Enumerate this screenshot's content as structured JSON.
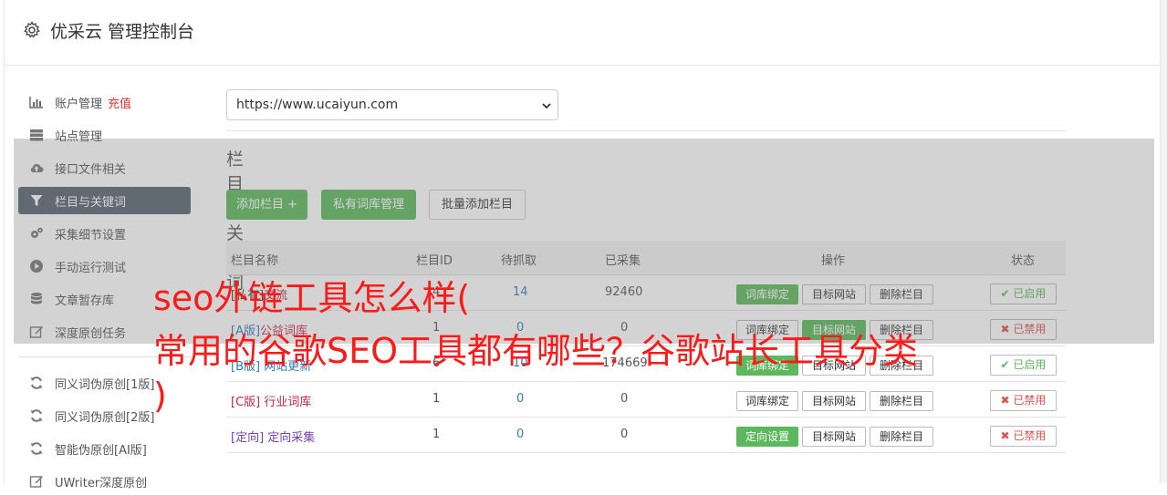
{
  "header": {
    "title": "优采云 管理控制台"
  },
  "sidebar": {
    "items": [
      {
        "label": "账户管理",
        "extra": "充值",
        "icon": "bar-chart-icon"
      },
      {
        "label": "站点管理",
        "icon": "server-icon"
      },
      {
        "label": "接口文件相关",
        "icon": "cloud-upload-icon"
      },
      {
        "label": "栏目与关键词",
        "icon": "filter-icon",
        "active": true
      },
      {
        "label": "采集细节设置",
        "icon": "cogs-icon"
      },
      {
        "label": "手动运行测试",
        "icon": "play-circle-icon"
      },
      {
        "label": "文章暂存库",
        "icon": "database-icon"
      },
      {
        "label": "深度原创任务",
        "icon": "edit-icon"
      }
    ],
    "items2": [
      {
        "label": "同义词伪原创[1版]",
        "icon": "refresh-icon"
      },
      {
        "label": "同义词伪原创[2版]",
        "icon": "refresh-icon"
      },
      {
        "label": "智能伪原创[AI版]",
        "icon": "refresh-icon"
      },
      {
        "label": "UWriter深度原创",
        "icon": "edit-icon"
      }
    ]
  },
  "main": {
    "site_select": "https://www.ucaiyun.com",
    "section_title": "栏目与关键词",
    "buttons": {
      "add": "添加栏目 +",
      "private": "私有词库管理",
      "batch": "批量添加栏目"
    }
  },
  "table": {
    "headers": {
      "name": "栏目名称",
      "id": "栏目ID",
      "pending": "待抓取",
      "collected": "已采集",
      "ops": "操作",
      "status": "状态"
    },
    "rows": [
      {
        "tag": "[私有]",
        "name": "交流",
        "id": "4",
        "pending": "14",
        "collected": "92460",
        "op1": "词库绑定",
        "op1_green": true,
        "op2": "目标网站",
        "op3": "删除栏目",
        "status": "已启用",
        "on": true
      },
      {
        "tag": "[A版]",
        "name": "公益词库",
        "id": "1",
        "pending": "0",
        "collected": "0",
        "op1": "词库绑定",
        "op1_green": false,
        "op2": "目标网站",
        "op2_green": true,
        "op3": "删除栏目",
        "status": "已禁用",
        "on": false
      },
      {
        "tag": "[B版]",
        "name": "网站更新",
        "id": "6",
        "pending": "10",
        "collected": "174669",
        "op1": "词库绑定",
        "op1_green": true,
        "op2": "目标网站",
        "op3": "删除栏目",
        "status": "已启用",
        "on": true
      },
      {
        "tag": "[C版]",
        "name": "行业词库",
        "id": "1",
        "pending": "0",
        "collected": "0",
        "op1": "词库绑定",
        "op1_green": false,
        "op2": "目标网站",
        "op3": "删除栏目",
        "status": "已禁用",
        "on": false
      },
      {
        "tag": "[定向]",
        "name": "定向采集",
        "id": "1",
        "pending": "0",
        "collected": "0",
        "op1": "定向设置",
        "op1_green": true,
        "op2": "目标网站",
        "op3": "删除栏目",
        "status": "已禁用",
        "on": false
      }
    ]
  },
  "headline": {
    "line1": "seo外链工具怎么样(",
    "line2": "常用的谷歌SEO工具都有哪些？谷歌站长工具分类",
    "line3": ")"
  },
  "colors": {
    "sidebar_active": "#566170",
    "green": "#5cb85c",
    "red": "#ff1a1a",
    "link_blue": "#337ab7"
  }
}
